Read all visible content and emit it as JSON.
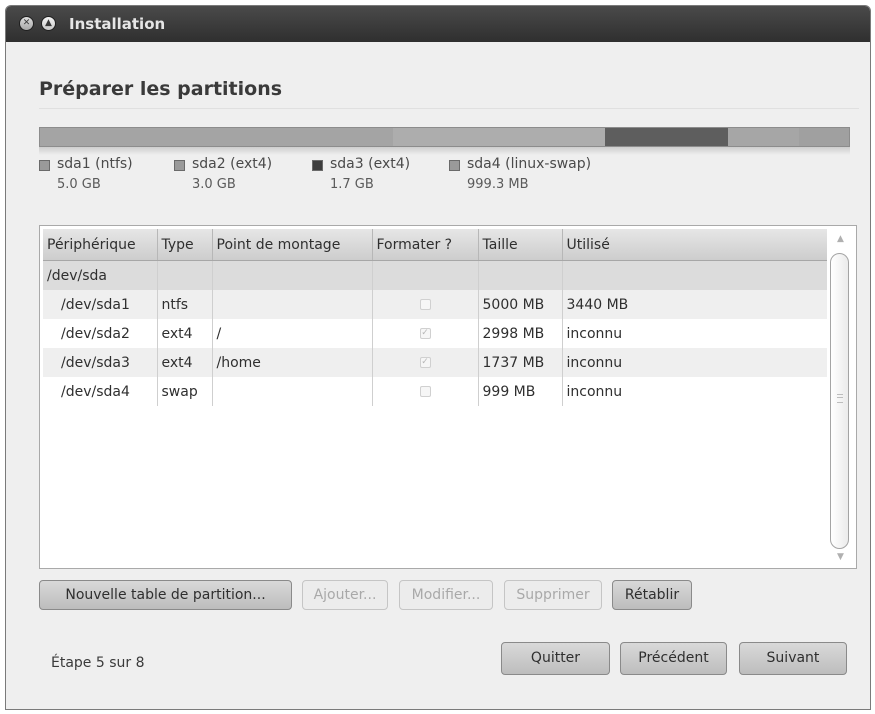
{
  "window": {
    "title": "Installation"
  },
  "page": {
    "heading": "Préparer les partitions"
  },
  "partition_bar": [
    {
      "name": "sda1",
      "fraction": 0.4367,
      "color": "#a4a4a4"
    },
    {
      "name": "sda2",
      "fraction": 0.262,
      "color": "#adadad"
    },
    {
      "name": "sda3",
      "fraction": 0.1516,
      "color": "#5e5e5e"
    },
    {
      "name": "sda4",
      "fraction": 0.0873,
      "color": "#a6a6a6"
    },
    {
      "name": "free",
      "fraction": 0.0624,
      "color": "#a0a0a0"
    }
  ],
  "legend": [
    {
      "name": "sda1 (ntfs)",
      "size": "5.0 GB",
      "color": "#9a9a9a"
    },
    {
      "name": "sda2 (ext4)",
      "size": "3.0 GB",
      "color": "#9a9a9a"
    },
    {
      "name": "sda3 (ext4)",
      "size": "1.7 GB",
      "color": "#3d3d3d"
    },
    {
      "name": "sda4 (linux-swap)",
      "size": "999.3 MB",
      "color": "#9a9a9a"
    }
  ],
  "table": {
    "columns": [
      "Périphérique",
      "Type",
      "Point de montage",
      "Formater ?",
      "Taille",
      "Utilisé"
    ],
    "group": "/dev/sda",
    "rows": [
      {
        "device": "/dev/sda1",
        "type": "ntfs",
        "mount": "",
        "format": false,
        "size": "5000 MB",
        "used": "3440 MB"
      },
      {
        "device": "/dev/sda2",
        "type": "ext4",
        "mount": "/",
        "format": true,
        "size": "2998 MB",
        "used": "inconnu"
      },
      {
        "device": "/dev/sda3",
        "type": "ext4",
        "mount": "/home",
        "format": true,
        "size": "1737 MB",
        "used": "inconnu"
      },
      {
        "device": "/dev/sda4",
        "type": "swap",
        "mount": "",
        "format": false,
        "size": "999 MB",
        "used": "inconnu"
      }
    ]
  },
  "actions": {
    "new_table": "Nouvelle table de partition...",
    "add": "Ajouter...",
    "modify": "Modifier...",
    "delete": "Supprimer",
    "revert": "Rétablir"
  },
  "footer": {
    "step": "Étape 5 sur 8",
    "quit": "Quitter",
    "previous": "Précédent",
    "next": "Suivant"
  },
  "icons": {
    "close": "close-icon",
    "maximize": "maximize-icon",
    "scroll_up": "scroll-up-arrow-icon",
    "scroll_down": "scroll-down-arrow-icon",
    "checkmark": "checkmark-icon"
  }
}
